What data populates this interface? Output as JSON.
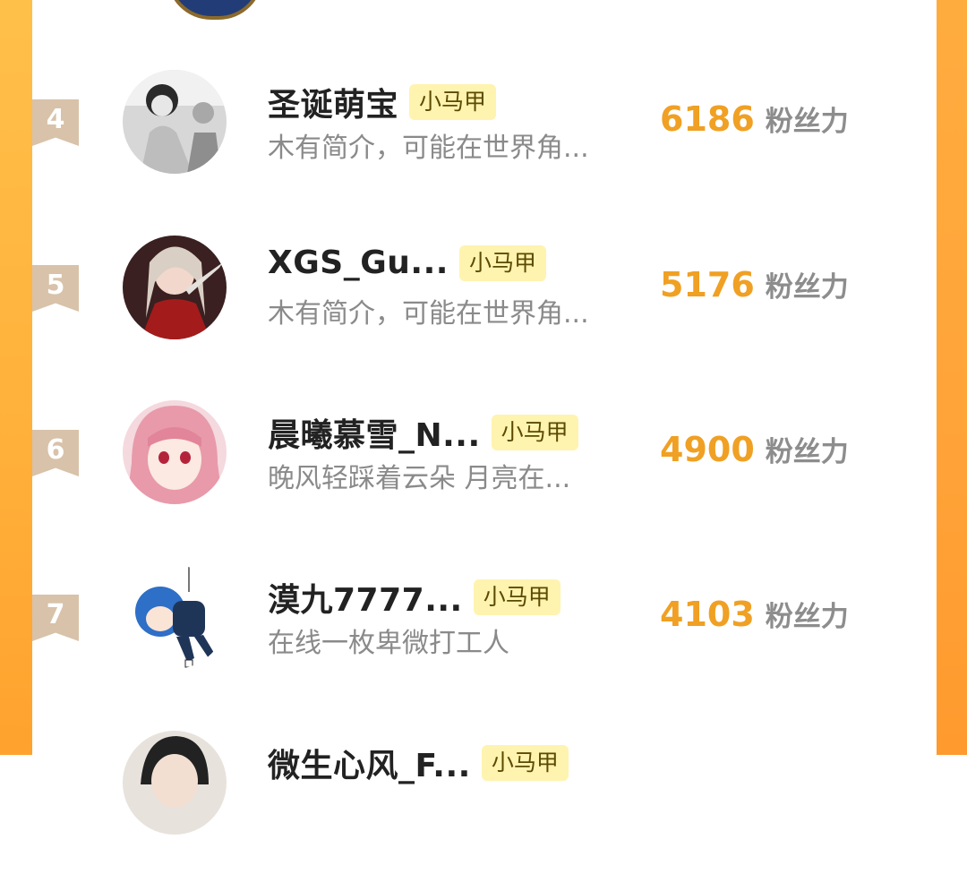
{
  "colors": {
    "accent_orange": "#f0a023",
    "frame_orange": "#ffb03a",
    "tag_bg": "#fff3b0",
    "rank_badge": "#d8c2a9"
  },
  "unit_label": "粉丝力",
  "rows": [
    {
      "rank": "4",
      "name": "圣诞萌宝",
      "tag": "小马甲",
      "bio": "木有简介，可能在世界角...",
      "score": "6186",
      "unit": "粉丝力",
      "avatar": "avatar-icon"
    },
    {
      "rank": "5",
      "name": "XGS_Gu...",
      "tag": "小马甲",
      "bio": "木有简介，可能在世界角...",
      "score": "5176",
      "unit": "粉丝力",
      "avatar": "avatar-icon"
    },
    {
      "rank": "6",
      "name": "晨曦慕雪_N...",
      "tag": "小马甲",
      "bio": "晚风轻踩着云朵 月亮在...",
      "score": "4900",
      "unit": "粉丝力",
      "avatar": "avatar-icon"
    },
    {
      "rank": "7",
      "name": "漠九7777...",
      "tag": "小马甲",
      "bio": "在线一枚卑微打工人",
      "score": "4103",
      "unit": "粉丝力",
      "avatar": "avatar-icon"
    },
    {
      "rank": "",
      "name": "微生心风_F...",
      "tag": "小马甲",
      "bio": "",
      "score": "",
      "unit": "",
      "avatar": "avatar-icon"
    }
  ]
}
